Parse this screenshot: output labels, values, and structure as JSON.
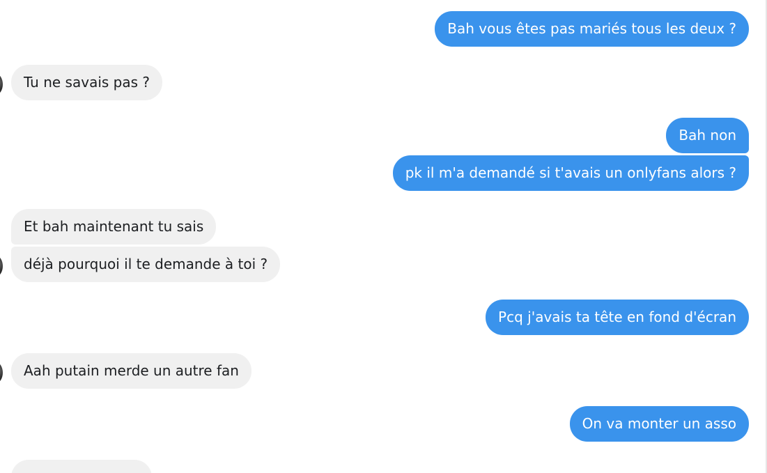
{
  "conversation": {
    "messages": [
      {
        "from": "me",
        "text": "Bah vous êtes pas mariés tous les deux ?"
      },
      {
        "from": "contact",
        "text": "Tu ne savais pas ?"
      },
      {
        "from": "me",
        "text": "Bah non"
      },
      {
        "from": "me",
        "text": "pk il m'a demandé si t'avais un onlyfans alors ?"
      },
      {
        "from": "contact",
        "text": "Et bah maintenant tu sais"
      },
      {
        "from": "contact",
        "text": "déjà pourquoi il te demande à toi ?"
      },
      {
        "from": "me",
        "text": "Pcq j'avais ta tête en fond d'écran"
      },
      {
        "from": "contact",
        "text": "Aah putain merde un autre fan"
      },
      {
        "from": "me",
        "text": "On va monter un asso"
      },
      {
        "from": "contact",
        "text": ""
      }
    ]
  },
  "colors": {
    "outgoing_bubble": "#3a93ec",
    "outgoing_text": "#ffffff",
    "incoming_bubble": "#f0f0f0",
    "incoming_text": "#1c1e21"
  }
}
